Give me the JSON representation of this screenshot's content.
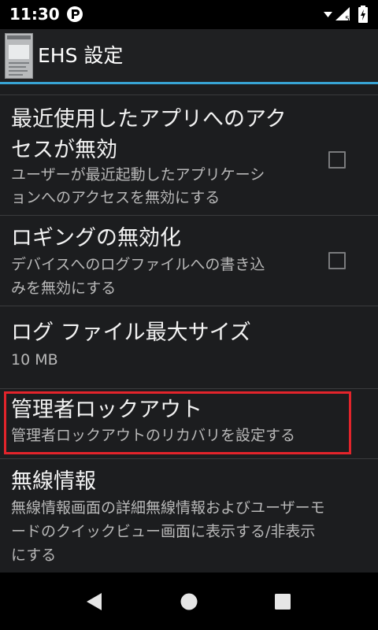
{
  "status_bar": {
    "time": "11:30",
    "icons": [
      "app-notification-icon",
      "wifi-icon",
      "mobile-signal-icon",
      "battery-charging-icon"
    ]
  },
  "action_bar": {
    "title": "EHS 設定",
    "app_icon": "ehs-app-thumbnail"
  },
  "settings": [
    {
      "title_lines": [
        "最近使用したアプリへのアク",
        "セスが無効"
      ],
      "summary_lines": [
        "ユーザーが最近起動したアプリケーシ",
        "ョンへのアクセスを無効にする"
      ],
      "checked": false
    },
    {
      "title_lines": [
        "ロギングの無効化"
      ],
      "summary_lines": [
        "デバイスへのログファイルへの書き込",
        "みを無効にする"
      ],
      "checked": false
    },
    {
      "title_lines": [
        "ログ ファイル最大サイズ"
      ],
      "summary_lines": [
        "10 MB"
      ]
    },
    {
      "title_lines": [
        "管理者ロックアウト"
      ],
      "summary_lines": [
        "管理者ロックアウトのリカバリを設定する"
      ],
      "highlighted": true
    },
    {
      "title_lines": [
        "無線情報"
      ],
      "summary_lines": [
        "無線情報画面の詳細無線情報およびユーザーモ",
        "ードのクイックビュー画面に表示する/非表示",
        "にする"
      ]
    }
  ],
  "colors": {
    "accent": "#38a4d4",
    "highlight": "#e3242b",
    "background": "#1c1d1f"
  },
  "navigation": {
    "buttons": [
      "back-icon",
      "home-icon",
      "recents-icon"
    ]
  }
}
